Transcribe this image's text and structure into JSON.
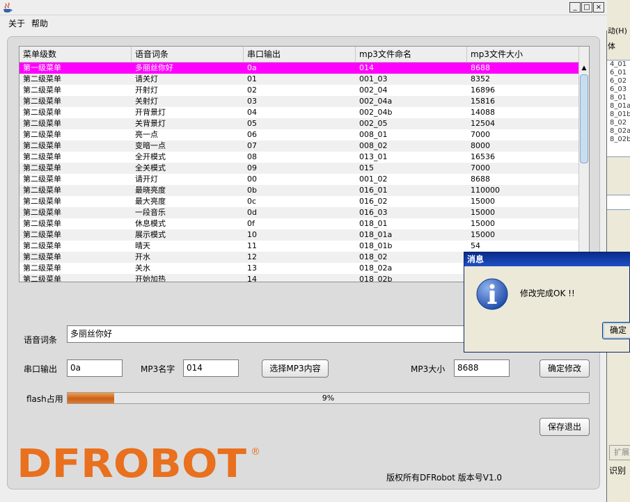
{
  "background_window": {
    "menu_text": "动(H)",
    "font_label": "体",
    "list_items": [
      "4_01",
      "6_01",
      "6_02",
      "6_03",
      "8_01",
      "8_01a",
      "8_01b",
      "8_02",
      "8_02a",
      "8_02b"
    ],
    "expand_button": "扩展",
    "recognize_label": "识别"
  },
  "window": {
    "controls": {
      "minimize": "_",
      "maximize": "□",
      "close": "×"
    }
  },
  "menubar": {
    "about": "关于",
    "help": "帮助"
  },
  "table": {
    "headers": [
      "菜单级数",
      "语音词条",
      "串口输出",
      "mp3文件命名",
      "mp3文件大小"
    ],
    "selected_index": 0,
    "rows": [
      [
        "第一级菜单",
        "多丽丝你好",
        "0a",
        "014",
        "8688"
      ],
      [
        "第二级菜单",
        "请关灯",
        "01",
        "001_03",
        "8352"
      ],
      [
        "第二级菜单",
        "开射灯",
        "02",
        "002_04",
        "16896"
      ],
      [
        "第二级菜单",
        "关射灯",
        "03",
        "002_04a",
        "15816"
      ],
      [
        "第二级菜单",
        "开背景灯",
        "04",
        "002_04b",
        "14088"
      ],
      [
        "第二级菜单",
        "关背景灯",
        "05",
        "002_05",
        "12504"
      ],
      [
        "第二级菜单",
        "亮一点",
        "06",
        "008_01",
        "7000"
      ],
      [
        "第二级菜单",
        "变暗一点",
        "07",
        "008_02",
        "8000"
      ],
      [
        "第二级菜单",
        "全开模式",
        "08",
        "013_01",
        "16536"
      ],
      [
        "第二级菜单",
        "全关模式",
        "09",
        "015",
        "7000"
      ],
      [
        "第二级菜单",
        "请开灯",
        "00",
        "001_02",
        "8688"
      ],
      [
        "第二级菜单",
        "最晓亮度",
        "0b",
        "016_01",
        "110000"
      ],
      [
        "第二级菜单",
        "最大亮度",
        "0c",
        "016_02",
        "15000"
      ],
      [
        "第二级菜单",
        "一段音乐",
        "0d",
        "016_03",
        "15000"
      ],
      [
        "第二级菜单",
        "休息模式",
        "0f",
        "018_01",
        "15000"
      ],
      [
        "第二级菜单",
        "展示模式",
        "10",
        "018_01a",
        "15000"
      ],
      [
        "第二级菜单",
        "晴天",
        "11",
        "018_01b",
        "54"
      ],
      [
        "第二级菜单",
        "开水",
        "12",
        "018_02",
        ""
      ],
      [
        "第二级菜单",
        "关水",
        "13",
        "018_02a",
        ""
      ],
      [
        "第二级菜单",
        "开始加热",
        "14",
        "018_02b",
        ""
      ]
    ]
  },
  "form": {
    "voice_label": "语音词条",
    "voice_value": "多丽丝你好",
    "serial_label": "串口输出",
    "serial_value": "0a",
    "mp3name_label": "MP3名字",
    "mp3name_value": "014",
    "choose_mp3_button": "选择MP3内容",
    "mp3size_label": "MP3大小",
    "mp3size_value": "8688",
    "confirm_button": "确定修改",
    "flash_label": "flash占用",
    "flash_percent_text": "9%",
    "flash_fraction": 0.09,
    "save_exit_button": "保存退出"
  },
  "logo": {
    "text": "DFROBOT",
    "registered": "®"
  },
  "copyright": "版权所有DFRobot 版本号V1.0",
  "dialog": {
    "title": "消息",
    "message": "修改完成OK !!",
    "ok_button": "确定"
  },
  "colors": {
    "selected_row": "#ff00ff",
    "logo_orange": "#e8701e",
    "progress_fill": "#d9722a",
    "dialog_title": "#0a2c8a"
  }
}
